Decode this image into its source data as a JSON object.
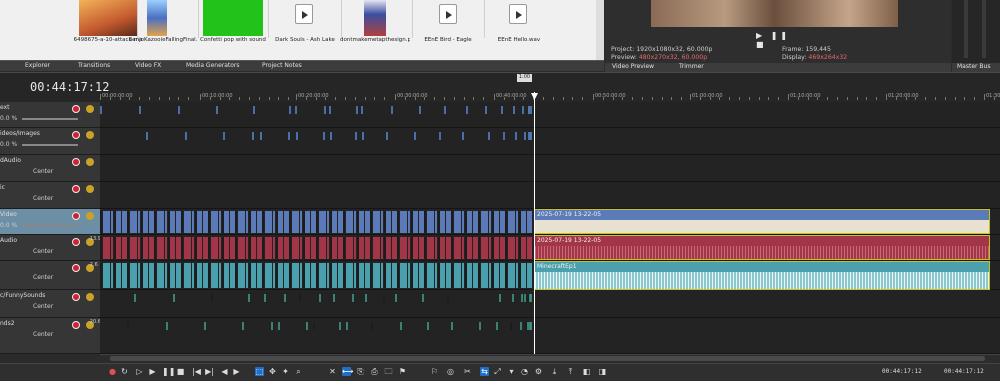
{
  "media": {
    "items": [
      {
        "label": "6498675-a-10-attack-ma",
        "kind": "image",
        "color": "#c77a3c"
      },
      {
        "label": "BanjoKazooieFallingFinal.",
        "kind": "image",
        "color": "#5a7fc0"
      },
      {
        "label": "Confetti pop with sound",
        "kind": "image",
        "color": "#22c21b"
      },
      {
        "label": "Dark Souls - Ash Lake",
        "kind": "audio"
      },
      {
        "label": "dontmakemetapthesign.p",
        "kind": "image",
        "color": "#3b4ea0"
      },
      {
        "label": "EEnE Bird - Eagle",
        "kind": "audio"
      },
      {
        "label": "EEnE Hello.wav",
        "kind": "audio"
      }
    ]
  },
  "tabs": {
    "explorer": "Explorer",
    "transitions": "Transitions",
    "video_fx": "Video FX",
    "media_generators": "Media Generators",
    "project_notes": "Project Notes",
    "video_preview": "Video Preview",
    "trimmer": "Trimmer",
    "master_bus": "Master Bus"
  },
  "preview_info": {
    "project_label": "Project:",
    "project_value": "1920x1080x32, 60.000p",
    "preview_label": "Preview:",
    "preview_value": "480x270x32, 60.000p",
    "frame_label": "Frame:",
    "frame_value": "159,445",
    "display_label": "Display:",
    "display_value": "469x264x32"
  },
  "timeline": {
    "timecode": "00:44:17:12",
    "end_time": "00:44:17:12",
    "end_time2": "00:44:17:12",
    "loop_label": "1:00",
    "ruler": [
      "00:00:00:00",
      "00:10:00:00",
      "00:20:00:00",
      "00:30:00:00",
      "00:40:00:00",
      "00:50:00:00",
      "01:00:00:00",
      "01:10:00:00",
      "01:20:00:00",
      "01:30:00:00"
    ]
  },
  "tracks": [
    {
      "name": "ext",
      "volume": "0.0 %",
      "kind": "video"
    },
    {
      "name": "ideos/Images",
      "volume": "0.0 %",
      "kind": "video"
    },
    {
      "name": "dAudio",
      "pan": "Center",
      "kind": "audio"
    },
    {
      "name": "ic",
      "pan": "Center",
      "kind": "audio"
    },
    {
      "name": "Video",
      "volume": "0.0 %",
      "kind": "video",
      "selected": true
    },
    {
      "name": "Audio",
      "pan": "Center",
      "db": "-13.9",
      "kind": "audio"
    },
    {
      "name": "",
      "pan": "Center",
      "db": "-2.6",
      "kind": "audio"
    },
    {
      "name": "c/FunnySounds",
      "pan": "Center",
      "kind": "audio"
    },
    {
      "name": "nds2",
      "pan": "Center",
      "db": "-20.6",
      "kind": "audio"
    }
  ],
  "events": {
    "video_event": "2025-07-19 13-22-05",
    "audio_event": "2025-07-19 13-22-05",
    "minecraft_event": "MinecraftEp1"
  },
  "colors": {
    "video_event": "#5a7bb8",
    "audio_event": "#a23648",
    "audio2_event": "#4aa0ad",
    "accent": "#1f6fc7"
  }
}
